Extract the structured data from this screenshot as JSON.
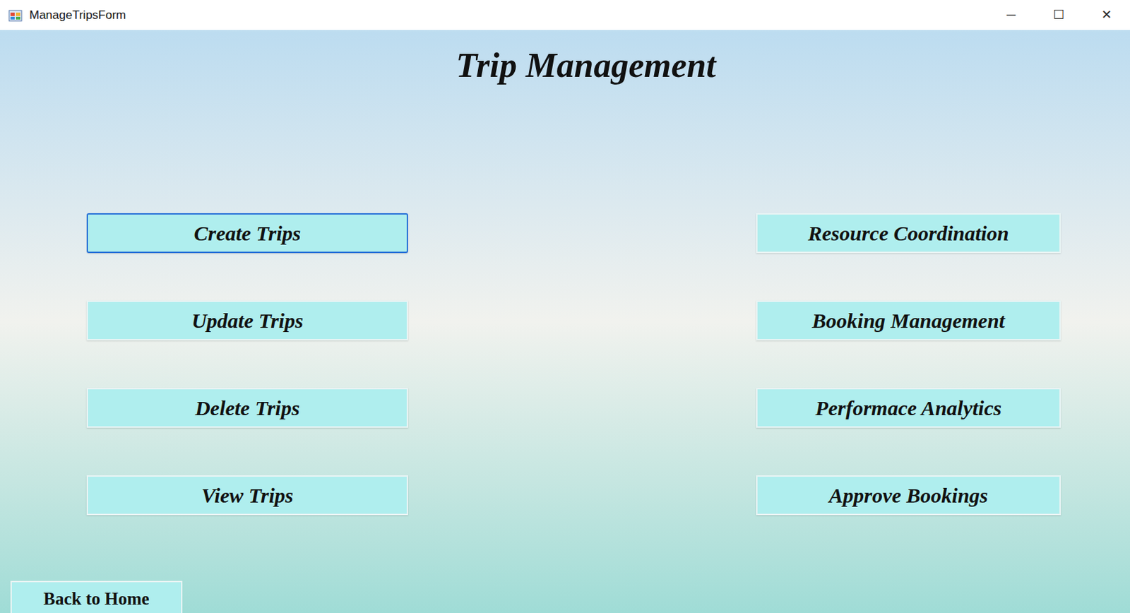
{
  "window": {
    "title": "ManageTripsForm",
    "controls": [
      "─",
      "☐",
      "✕"
    ]
  },
  "heading": "Trip Management",
  "buttons": [
    {
      "label": "Create Trips",
      "column": "left",
      "focused": true
    },
    {
      "label": "Update Trips",
      "column": "left",
      "focused": false
    },
    {
      "label": "Delete Trips",
      "column": "left",
      "focused": false
    },
    {
      "label": "View Trips",
      "column": "left",
      "focused": false
    },
    {
      "label": "Resource Coordination",
      "column": "right",
      "focused": false
    },
    {
      "label": "Booking Management",
      "column": "right",
      "focused": false
    },
    {
      "label": "Performace Analytics",
      "column": "right",
      "focused": false
    },
    {
      "label": "Approve Bookings",
      "column": "right",
      "focused": false
    }
  ],
  "back_button": {
    "label": "Back to Home",
    "focused": false
  }
}
